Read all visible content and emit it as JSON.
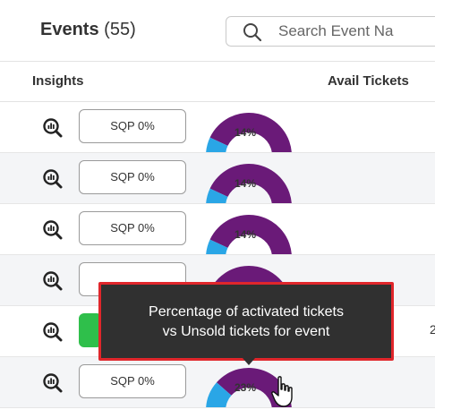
{
  "header": {
    "title": "Events",
    "count": "(55)",
    "search_placeholder": "Search Event Na"
  },
  "columns": {
    "insights": "Insights",
    "avail_tickets": "Avail Tickets"
  },
  "rows": [
    {
      "sqp": "SQP 0%",
      "percent": "14%",
      "value": 14,
      "alt": false,
      "icon": "insights-zoom-icon"
    },
    {
      "sqp": "SQP 0%",
      "percent": "14%",
      "value": 14,
      "alt": true,
      "icon": "insights-zoom-icon"
    },
    {
      "sqp": "SQP 0%",
      "percent": "14%",
      "value": 14,
      "alt": false,
      "icon": "insights-zoom-icon"
    },
    {
      "sqp": "",
      "percent": "",
      "value": 0,
      "alt": true,
      "icon": "insights-zoom-icon"
    },
    {
      "sqp": "",
      "percent": "",
      "value": 0,
      "alt": false,
      "icon": "insights-zoom-icon",
      "green": true,
      "trail": "2"
    },
    {
      "sqp": "SQP 0%",
      "percent": "23%",
      "value": 23,
      "alt": true,
      "icon": "insights-zoom-icon"
    }
  ],
  "tooltip": {
    "line1": "Percentage of activated tickets",
    "line2": "vs Unsold tickets for event"
  },
  "colors": {
    "gauge_main": "#6a1a78",
    "gauge_active": "#2aa6e6",
    "tooltip_bg": "#303030",
    "tooltip_border": "#e0262b",
    "sqp_green": "#2fbf4b"
  }
}
